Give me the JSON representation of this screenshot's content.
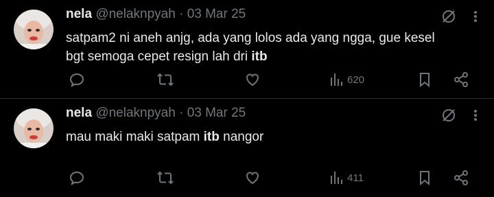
{
  "tweets": [
    {
      "author": "nela",
      "handle": "@nelaknpyah",
      "separator": "·",
      "date": "03 Mar 25",
      "text_parts": [
        "satpam2 ni aneh anjg, ada yang lolos ada yang ngga, gue kesel bgt semoga cepet resign lah dri ",
        "itb",
        ""
      ],
      "views": "620"
    },
    {
      "author": "nela",
      "handle": "@nelaknpyah",
      "separator": "·",
      "date": "03 Mar 25",
      "text_parts": [
        "mau maki maki satpam ",
        "itb",
        " nangor"
      ],
      "views": "411"
    }
  ],
  "icons": {
    "grok": "grok-icon",
    "more": "more-icon",
    "reply": "reply-icon",
    "retweet": "retweet-icon",
    "like": "like-icon",
    "views": "views-icon",
    "bookmark": "bookmark-icon",
    "share": "share-icon"
  },
  "colors": {
    "background": "#000000",
    "text": "#e7e9ea",
    "muted": "#71767b",
    "divider": "#2f3336"
  }
}
